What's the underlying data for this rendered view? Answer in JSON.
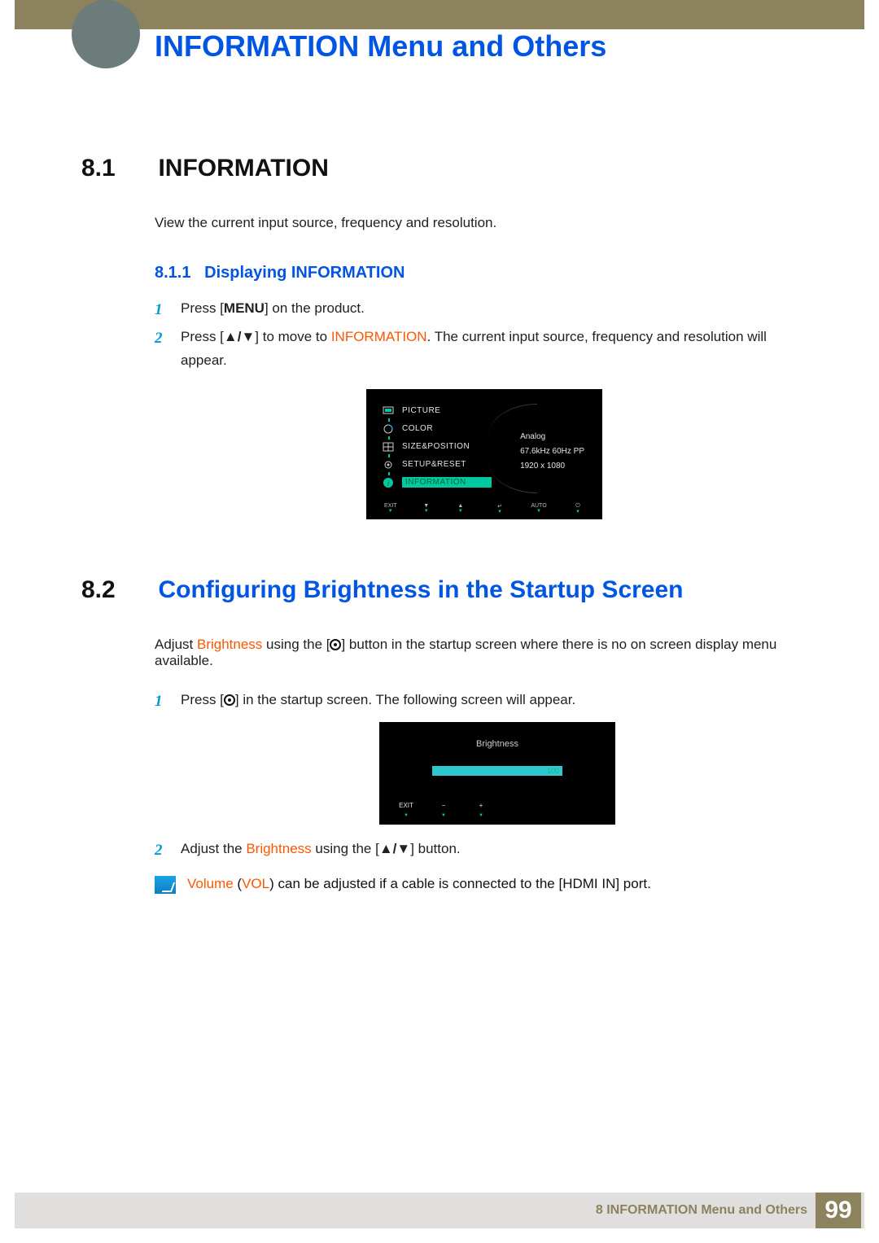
{
  "chapter": {
    "title": "INFORMATION Menu and Others"
  },
  "sec81": {
    "num": "8.1",
    "title": "INFORMATION",
    "desc": "View the current input source, frequency and resolution.",
    "sub": {
      "num": "8.1.1",
      "title": "Displaying INFORMATION",
      "step1_a": "Press [",
      "step1_menu": "MENU",
      "step1_b": "] on the product.",
      "step2_a": "Press [",
      "step2_arrows": "▲/▼",
      "step2_b": "] to move to ",
      "step2_kw": "INFORMATION",
      "step2_c": ". The current input source, frequency and resolution will appear."
    }
  },
  "osd1": {
    "menu": {
      "picture": "PICTURE",
      "color": "COLOR",
      "sizepos": "SIZE&POSITION",
      "setup": "SETUP&RESET",
      "info": "INFORMATION"
    },
    "pane": {
      "source": "Analog",
      "freq": "67.6kHz 60Hz PP",
      "res": "1920 x 1080"
    },
    "btns": {
      "exit": "EXIT",
      "down": "▼",
      "up": "▲",
      "enter": "↵",
      "auto": "AUTO",
      "power": "⏻"
    }
  },
  "sec82": {
    "num": "8.2",
    "title": "Configuring Brightness in the Startup Screen",
    "para_a": "Adjust ",
    "para_kw": "Brightness",
    "para_b": " using the [",
    "para_c": "] button in the startup screen where there is no on screen display menu available.",
    "step1_a": "Press [",
    "step1_b": "] in the startup screen. The following screen will appear.",
    "step2_a": "Adjust the ",
    "step2_kw": "Brightness",
    "step2_b": " using the [",
    "step2_arrows": "▲/▼",
    "step2_c": "] button.",
    "note_a": "Volume",
    "note_b": " (",
    "note_c": "VOL",
    "note_d": ") can be adjusted if a cable is connected to the [HDMI IN] port."
  },
  "osd2": {
    "title": "Brightness",
    "value": "100",
    "btns": {
      "exit": "EXIT",
      "minus": "−",
      "plus": "+"
    }
  },
  "footer": {
    "text": "8 INFORMATION Menu and Others",
    "page": "99"
  }
}
